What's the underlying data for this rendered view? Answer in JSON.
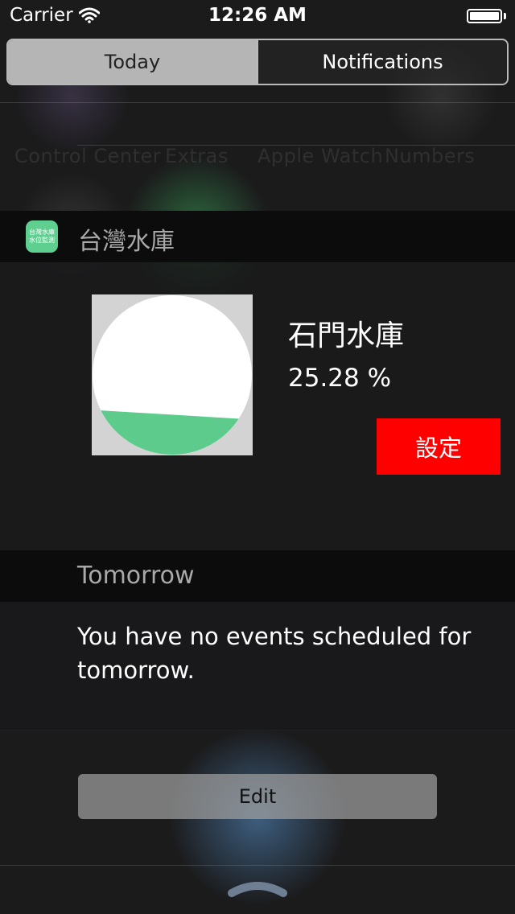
{
  "status_bar": {
    "carrier": "Carrier",
    "time": "12:26 AM",
    "battery_level": 1.0
  },
  "segmented_control": {
    "today_label": "Today",
    "notifications_label": "Notifications",
    "selected": "Today"
  },
  "widget": {
    "title": "台灣水庫",
    "app_icon_text": "台灣水庫水位監測",
    "icon_color": "#5ecf8f",
    "reservoir_name": "石門水庫",
    "percentage_text": "25.28 %",
    "water_level": 0.2528,
    "settings_label": "設定",
    "settings_color": "#fe0000"
  },
  "tomorrow": {
    "title": "Tomorrow",
    "message": "You have no events scheduled for tomorrow."
  },
  "footer": {
    "edit_label": "Edit"
  }
}
